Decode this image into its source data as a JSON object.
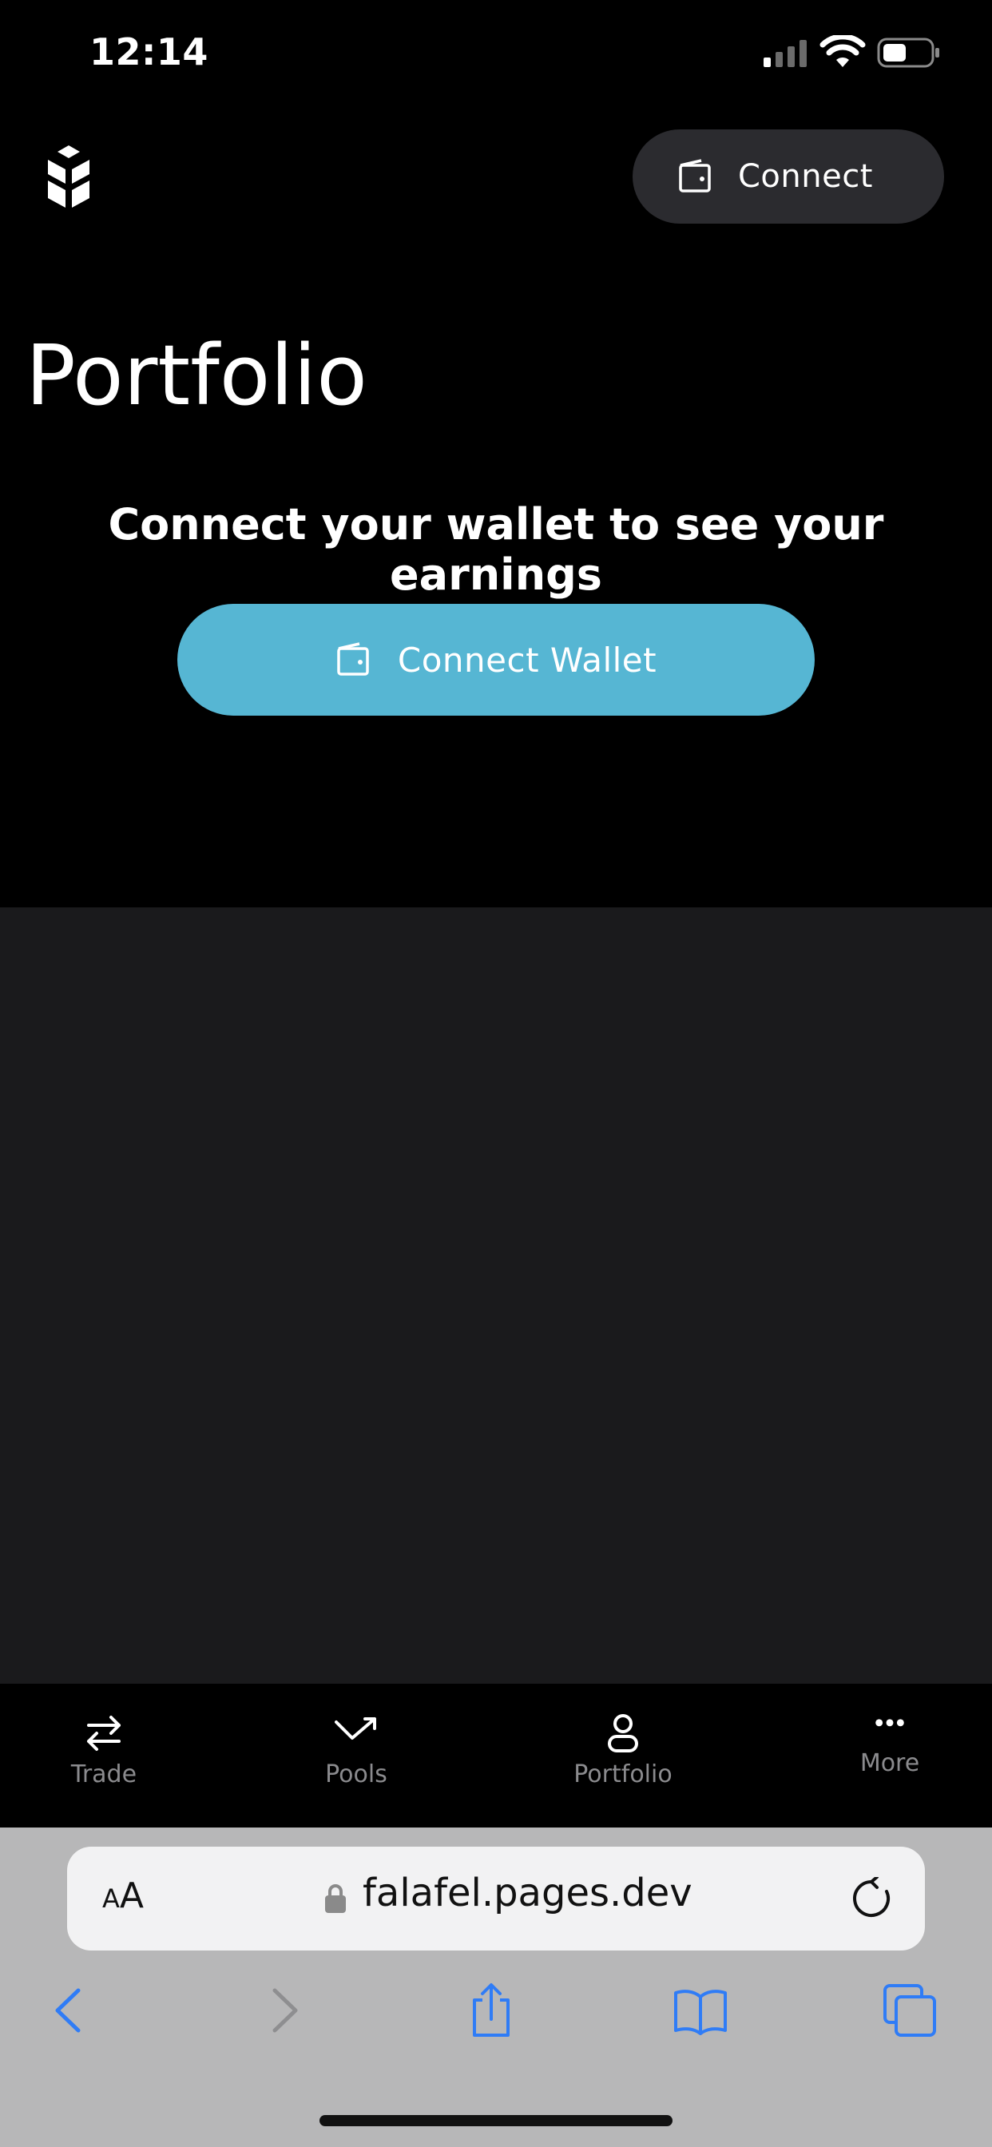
{
  "status_bar": {
    "time": "12:14",
    "icons": [
      "cellular-signal-icon",
      "wifi-icon",
      "battery-icon"
    ]
  },
  "header": {
    "logo": "brand-logo-icon",
    "connect_label": "Connect"
  },
  "main": {
    "title": "Portfolio",
    "prompt": "Connect your wallet to see your earnings",
    "connect_wallet_label": "Connect Wallet"
  },
  "bottom_nav": {
    "items": [
      {
        "label": "Trade",
        "icon": "swap-arrows-icon"
      },
      {
        "label": "Pools",
        "icon": "trend-arrow-icon"
      },
      {
        "label": "Portfolio",
        "icon": "user-icon"
      },
      {
        "label": "More",
        "icon": "more-dots-icon"
      }
    ]
  },
  "browser": {
    "text_size_label_small": "A",
    "text_size_label_large": "A",
    "url": "falafel.pages.dev",
    "toolbar_icons": [
      "back-icon",
      "forward-icon",
      "share-icon",
      "bookmarks-icon",
      "tabs-icon"
    ]
  },
  "colors": {
    "background": "#000000",
    "panel": "#1a1a1c",
    "accent": "#56b6d3",
    "nav_text": "#8b8b8e",
    "browser_chrome": "#b7b7b8",
    "link_blue": "#2f7cf6"
  }
}
